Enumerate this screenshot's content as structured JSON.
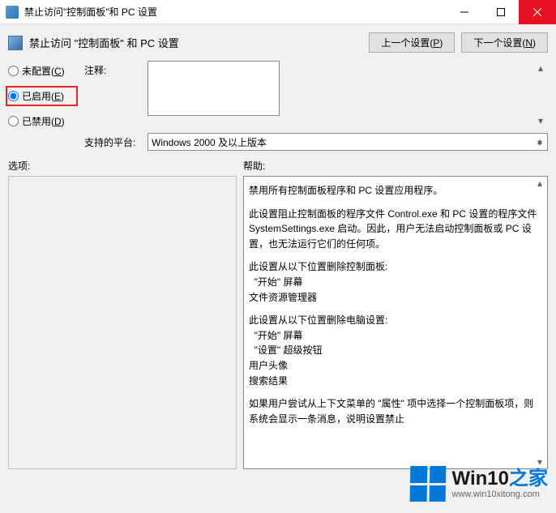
{
  "titlebar": {
    "title": "禁止访问\"控制面板\"和 PC 设置"
  },
  "header": {
    "title": "禁止访问 \"控制面板\" 和 PC 设置",
    "faint_mark": "",
    "prev_label": "上一个设置(P)",
    "next_label": "下一个设置(N)"
  },
  "config": {
    "not_configured": "未配置(C)",
    "enabled": "已启用(E)",
    "disabled": "已禁用(D)",
    "selected": "enabled"
  },
  "comment": {
    "label": "注释:",
    "value": ""
  },
  "platform": {
    "label": "支持的平台:",
    "value": "Windows 2000 及以上版本"
  },
  "options": {
    "label": "选项:"
  },
  "help": {
    "label": "帮助:",
    "paragraphs": [
      "禁用所有控制面板程序和 PC 设置应用程序。",
      "此设置阻止控制面板的程序文件 Control.exe 和 PC 设置的程序文件 SystemSettings.exe 启动。因此，用户无法启动控制面板或 PC 设置，也无法运行它们的任何项。",
      "此设置从以下位置删除控制面板:\n  \"开始\" 屏幕\n文件资源管理器",
      "此设置从以下位置删除电脑设置:\n  \"开始\" 屏幕\n  \"设置\" 超级按钮\n用户头像\n搜索结果",
      "如果用户尝试从上下文菜单的 \"属性\" 项中选择一个控制面板项，则系统会显示一条消息，说明设置禁止"
    ]
  },
  "watermark": {
    "brand_main": "Win10",
    "brand_suffix": "之家",
    "url": "www.win10xitong.com"
  }
}
